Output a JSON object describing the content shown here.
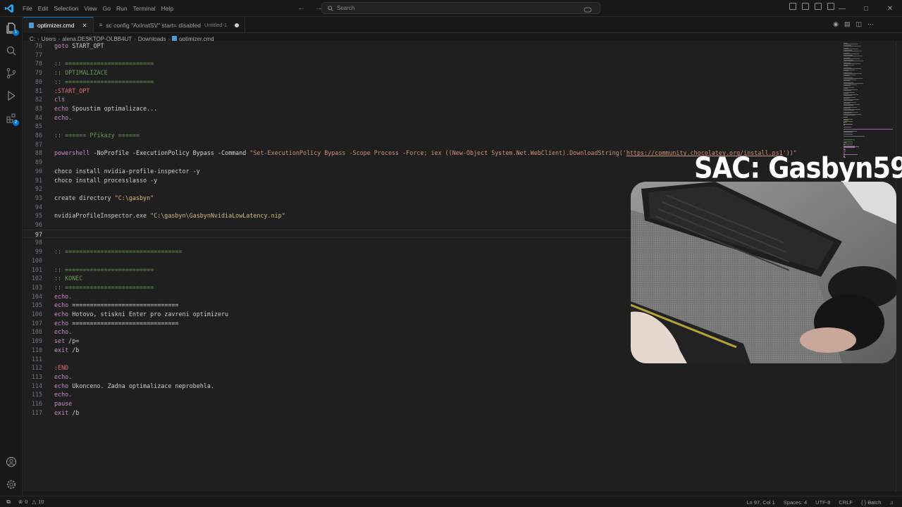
{
  "titlebar": {
    "menu": [
      "File",
      "Edit",
      "Selection",
      "View",
      "Go",
      "Run",
      "Terminal",
      "Help"
    ],
    "search_placeholder": "Search"
  },
  "activitybar": {
    "items": [
      {
        "icon": "explorer-icon",
        "badge": "1"
      },
      {
        "icon": "search-icon",
        "badge": ""
      },
      {
        "icon": "source-control-icon",
        "badge": ""
      },
      {
        "icon": "run-debug-icon",
        "badge": ""
      },
      {
        "icon": "extensions-icon",
        "badge": "2"
      }
    ],
    "bottom": [
      "account-icon",
      "settings-gear-icon"
    ]
  },
  "tabs": [
    {
      "label": "optimizer.cmd",
      "active": true,
      "description": ""
    },
    {
      "label": "sc config \"AxInstSV\" start= disabled",
      "active": false,
      "description": "Untitled-1"
    }
  ],
  "breadcrumb": [
    "C:",
    "Users",
    "alena.DESKTOP-OLBB4UT",
    "Downloads",
    "optimizer.cmd"
  ],
  "editor": {
    "current_line": 97,
    "lines": [
      {
        "n": "76",
        "parts": [
          [
            "kw",
            "goto"
          ],
          [
            "plain",
            " START_OPT"
          ]
        ]
      },
      {
        "n": "77",
        "parts": []
      },
      {
        "n": "78",
        "parts": [
          [
            "cmt",
            ":: ========================="
          ]
        ]
      },
      {
        "n": "79",
        "parts": [
          [
            "cmt",
            ":: OPTIMALIZACE"
          ]
        ]
      },
      {
        "n": "80",
        "parts": [
          [
            "cmt",
            ":: ========================="
          ]
        ]
      },
      {
        "n": "81",
        "parts": [
          [
            "lbl",
            ":START_OPT"
          ]
        ]
      },
      {
        "n": "82",
        "parts": [
          [
            "kw",
            "cls"
          ]
        ]
      },
      {
        "n": "83",
        "parts": [
          [
            "kw",
            "echo"
          ],
          [
            "plain",
            " Spoustim optimalizace..."
          ]
        ]
      },
      {
        "n": "84",
        "parts": [
          [
            "kw",
            "echo."
          ]
        ]
      },
      {
        "n": "85",
        "parts": []
      },
      {
        "n": "86",
        "parts": [
          [
            "cmt",
            ":: ====== Příkazy ======"
          ]
        ]
      },
      {
        "n": "87",
        "parts": []
      },
      {
        "n": "88",
        "parts": [
          [
            "ps",
            "powershell"
          ],
          [
            "arg",
            " -NoProfile -ExecutionPolicy Bypass -Command "
          ],
          [
            "str",
            "\"Set-ExecutionPolicy Bypass -Scope Process -Force; iex ((New-Object System.Net.WebClient).DownloadString('"
          ],
          [
            "url",
            "https://community.chocolatey.org/install.ps1"
          ],
          [
            "str",
            "'))\""
          ]
        ]
      },
      {
        "n": "89",
        "parts": []
      },
      {
        "n": "90",
        "parts": [
          [
            "plain",
            "choco install nvidia-profile-inspector -y"
          ]
        ]
      },
      {
        "n": "91",
        "parts": [
          [
            "plain",
            "choco install processlasso -y"
          ]
        ]
      },
      {
        "n": "92",
        "parts": []
      },
      {
        "n": "93",
        "parts": [
          [
            "plain",
            "create directory "
          ],
          [
            "str2",
            "\"C:\\gasbyn\""
          ]
        ]
      },
      {
        "n": "94",
        "parts": []
      },
      {
        "n": "95",
        "parts": [
          [
            "plain",
            "nvidiaProfileInspector.exe "
          ],
          [
            "str2",
            "\"C:\\gasbyn\\GasbynNvidiaLowLatency.nip\""
          ]
        ]
      },
      {
        "n": "96",
        "parts": []
      },
      {
        "n": "97",
        "parts": []
      },
      {
        "n": "98",
        "parts": []
      },
      {
        "n": "99",
        "parts": [
          [
            "cmt",
            ":: ================================="
          ]
        ]
      },
      {
        "n": "100",
        "parts": []
      },
      {
        "n": "101",
        "parts": [
          [
            "cmt",
            ":: ========================="
          ]
        ]
      },
      {
        "n": "102",
        "parts": [
          [
            "cmt",
            ":: KONEC"
          ]
        ]
      },
      {
        "n": "103",
        "parts": [
          [
            "cmt",
            ":: ========================="
          ]
        ]
      },
      {
        "n": "104",
        "parts": [
          [
            "kw",
            "echo."
          ]
        ]
      },
      {
        "n": "105",
        "parts": [
          [
            "kw",
            "echo"
          ],
          [
            "plain",
            " =============================="
          ]
        ]
      },
      {
        "n": "106",
        "parts": [
          [
            "kw",
            "echo"
          ],
          [
            "plain",
            " Hotovo, stiskni Enter pro zavreni optimizeru"
          ]
        ]
      },
      {
        "n": "107",
        "parts": [
          [
            "kw",
            "echo"
          ],
          [
            "plain",
            " =============================="
          ]
        ]
      },
      {
        "n": "108",
        "parts": [
          [
            "kw",
            "echo."
          ]
        ]
      },
      {
        "n": "109",
        "parts": [
          [
            "kw",
            "set"
          ],
          [
            "plain",
            " /p="
          ]
        ]
      },
      {
        "n": "110",
        "parts": [
          [
            "kw",
            "exit"
          ],
          [
            "plain",
            " /b"
          ]
        ]
      },
      {
        "n": "111",
        "parts": []
      },
      {
        "n": "112",
        "parts": [
          [
            "lbl",
            ":END"
          ]
        ]
      },
      {
        "n": "113",
        "parts": [
          [
            "kw",
            "echo."
          ]
        ]
      },
      {
        "n": "114",
        "parts": [
          [
            "kw",
            "echo"
          ],
          [
            "plain",
            " Ukonceno. Zadna optimalizace neprobehla."
          ]
        ]
      },
      {
        "n": "115",
        "parts": [
          [
            "kw",
            "echo."
          ]
        ]
      },
      {
        "n": "116",
        "parts": [
          [
            "kw",
            "pause"
          ]
        ]
      },
      {
        "n": "117",
        "parts": [
          [
            "kw",
            "exit"
          ],
          [
            "plain",
            " /b"
          ]
        ]
      }
    ]
  },
  "overlay": {
    "title": "SAC: Gasbyn59"
  },
  "statusbar": {
    "errors": "0",
    "warnings": "10",
    "position": "Ln 97, Col 1",
    "spaces": "Spaces: 4",
    "encoding": "UTF-8",
    "eol": "CRLF",
    "language": "Batch"
  },
  "colors": {
    "accent": "#0078d4",
    "keyword": "#c586c0",
    "comment": "#6a9955",
    "string": "#ce9178",
    "label": "#e06c75"
  }
}
